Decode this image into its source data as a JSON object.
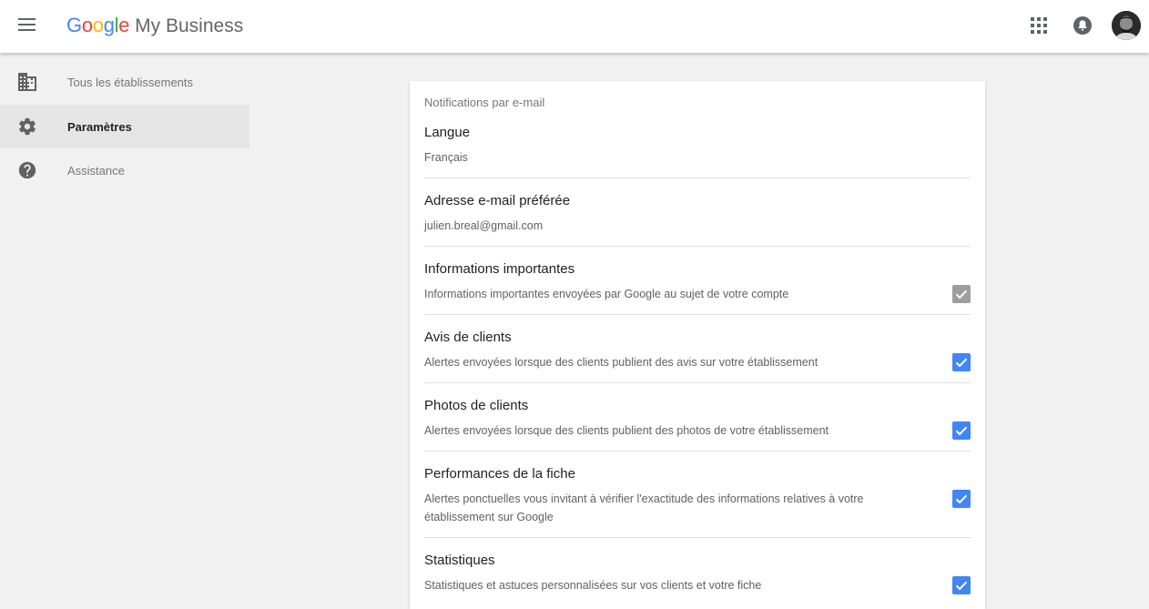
{
  "header": {
    "logo_letters": [
      "G",
      "o",
      "o",
      "g",
      "l",
      "e"
    ],
    "product_name": "My Business",
    "icons": [
      "menu-icon",
      "apps-grid-icon",
      "notifications-icon",
      "account-avatar"
    ]
  },
  "sidebar": {
    "items": [
      {
        "label": "Tous les établissements",
        "icon": "building-icon",
        "active": false
      },
      {
        "label": "Paramètres",
        "icon": "gear-icon",
        "active": true
      },
      {
        "label": "Assistance",
        "icon": "help-icon",
        "active": false
      }
    ]
  },
  "main": {
    "card_title": "Notifications par e-mail",
    "settings": [
      {
        "title": "Langue",
        "description": "Français"
      },
      {
        "title": "Adresse e-mail préférée",
        "description": "julien.breal@gmail.com"
      },
      {
        "title": "Informations importantes",
        "description": "Informations importantes envoyées par Google au sujet de votre compte",
        "checked": true,
        "disabled": true
      },
      {
        "title": "Avis de clients",
        "description": "Alertes envoyées lorsque des clients publient des avis sur votre établissement",
        "checked": true
      },
      {
        "title": "Photos de clients",
        "description": "Alertes envoyées lorsque des clients publient des photos de votre établissement",
        "checked": true
      },
      {
        "title": "Performances de la fiche",
        "description": "Alertes ponctuelles vous invitant à vérifier l'exactitude des informations relatives à votre établissement sur Google",
        "checked": true
      },
      {
        "title": "Statistiques",
        "description": "Statistiques et astuces personnalisées sur vos clients et votre fiche",
        "checked": true
      }
    ]
  },
  "colors": {
    "checkbox_checked": "#4285f4",
    "checkbox_disabled": "#9e9e9e",
    "active_nav_bg": "#e5e5e5",
    "page_bg": "#f1f1f1"
  }
}
